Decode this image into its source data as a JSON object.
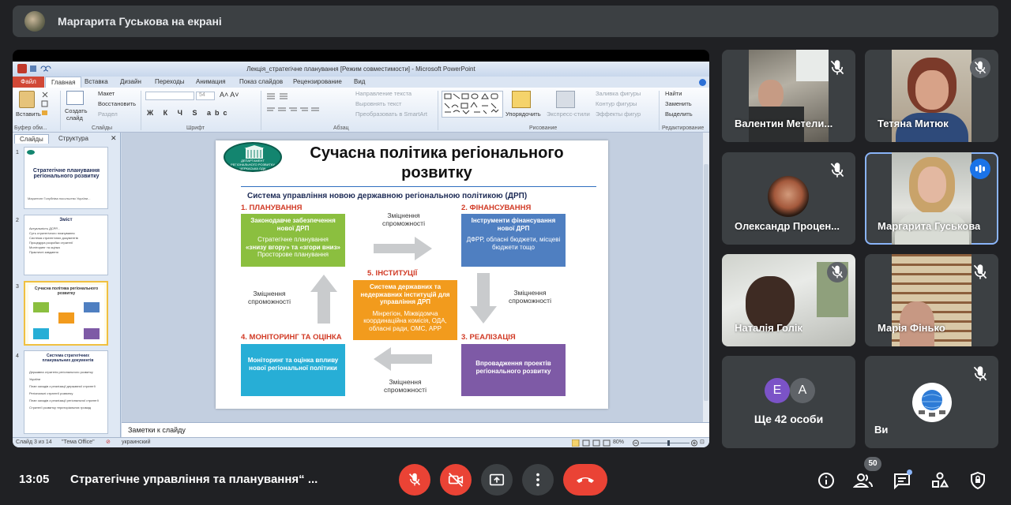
{
  "banner": {
    "presenter_title": "Маргарита Гуськова на екрані"
  },
  "powerpoint": {
    "window_title": "Лекція_стратегічне планування [Режим совместимости] - Microsoft PowerPoint",
    "file_tab": "Файл",
    "tabs": [
      "Главная",
      "Вставка",
      "Дизайн",
      "Переходы",
      "Анимация",
      "Показ слайдов",
      "Рецензирование",
      "Вид"
    ],
    "ribbon": {
      "paste": "Вставить",
      "clipboard": "Буфер обм...",
      "layout": "Макет",
      "reset": "Восстановить",
      "section": "Раздел",
      "new_slide_1": "Создать",
      "new_slide_2": "слайд",
      "slides": "Слайды",
      "font_size": "54",
      "font": "Шрифт",
      "text_direction": "Направление текста",
      "align_text": "Выровнять текст",
      "smartart": "Преобразовать в SmartArt",
      "paragraph": "Абзац",
      "arrange": "Упорядочить",
      "quick_styles": "Экспресс-стили",
      "fill": "Заливка фигуры",
      "outline": "Контур фигуры",
      "effects": "Эффекты фигур",
      "drawing": "Рисование",
      "find": "Найти",
      "replace": "Заменить",
      "select": "Выделить",
      "editing": "Редактирование"
    },
    "pane_tabs": [
      "Слайды",
      "Структура"
    ],
    "thumbnails": [
      {
        "num": "1",
        "title": "Стратегічне планування регіонального розвитку",
        "footer": "Маркетинг Голубніва посольство України..."
      },
      {
        "num": "2",
        "title": "Зміст",
        "lines": [
          "Актуальність ДСРР...",
          "Суть стратегічного планування",
          "Система стратегічних документів",
          "Процедура розробки стратегії",
          "Моніторинг та оцінка",
          "Практичні завдання"
        ]
      },
      {
        "num": "3",
        "title": "Сучасна політика регіонального розвитку"
      },
      {
        "num": "4",
        "title": "Система стратегічних планувальних документів",
        "lines": [
          "Державна стратегія регіонального розвитку України",
          "План заходів з реалізації державної стратегії",
          "Регіональні стратегії розвитку",
          "План заходів з реалізації регіональної стратегії",
          "Стратегії розвитку територіальних громад"
        ]
      }
    ],
    "notes_placeholder": "Заметки к слайду",
    "status": {
      "slide": "Слайд 3 из 14",
      "theme": "\"Тема Office\"",
      "lang": "украинский",
      "zoom": "80%"
    }
  },
  "slide": {
    "logo": "ДЕПАРТАМЕНТ РЕГІОНАЛЬНОГО РОЗВИТКУ ЧЕРКАСЬКА ОДА",
    "title": "Сучасна політика регіонального розвитку",
    "subtitle": "Система управління новою державною регіональною політикою (ДРП)",
    "sections": {
      "planning": "1. ПЛАНУВАННЯ",
      "finance": "2. ФІНАНСУВАННЯ",
      "realization": "3. РЕАЛІЗАЦІЯ",
      "monitoring": "4. МОНІТОРИНГ ТА ОЦІНКА",
      "institutions": "5. ІНСТИТУЦІЇ"
    },
    "boxes": {
      "planning_head": "Законодавче забезпечення нової ДРП",
      "planning_l1": "Стратегічне планування",
      "planning_l2": "«знизу вгору» та «згори вниз»",
      "planning_l3": "Просторове планування",
      "finance_head": "Інструменти фінансування нової ДРП",
      "finance_body": "ДФРР, обласні бюджети, місцеві бюджети тощо",
      "institutions_head": "Система державних та недержавних інституцій для управління ДРП",
      "institutions_body": "Мінрегіон, Міжвідомча координаційна комісія, ОДА, обласні ради, ОМС, АРР",
      "realization_body": "Впровадження проектів регіонального розвитку",
      "monitoring_body": "Моніторинг та оцінка впливу нової регіональної політики"
    },
    "capacity": "Зміцнення спроможності"
  },
  "participants": [
    {
      "name": "Валентин Метели...",
      "muted": true
    },
    {
      "name": "Тетяна Митюк",
      "muted": true
    },
    {
      "name": "Олександр Процен...",
      "muted": true
    },
    {
      "name": "Маргарита Гуськова",
      "speaking": true
    },
    {
      "name": "Наталія Голік",
      "muted": true
    },
    {
      "name": "Марія Фінько",
      "muted": true
    },
    {
      "name": "Ще 42 особи",
      "avatars": [
        "Е",
        "А"
      ]
    },
    {
      "name": "Ви",
      "muted": true
    }
  ],
  "colors": {
    "muted_icon_bg": "#5f6368",
    "speaking_badge": "#1a73e8",
    "control_red": "#ea4335",
    "control_gray": "#3c4043",
    "planning": "#8bbf3f",
    "finance": "#4f7fc1",
    "institutions": "#f29b1d",
    "realization": "#7e5aa6",
    "monitoring": "#27aed6"
  },
  "bottom_bar": {
    "time": "13:05",
    "meeting_title": "Стратегічне управління та планування“ ...",
    "people_count": "50",
    "icons": [
      "mic-off-icon",
      "camera-off-icon",
      "present-icon",
      "more-icon",
      "hang-up-icon",
      "info-icon",
      "people-icon",
      "chat-icon",
      "activities-icon",
      "host-controls-icon"
    ]
  }
}
